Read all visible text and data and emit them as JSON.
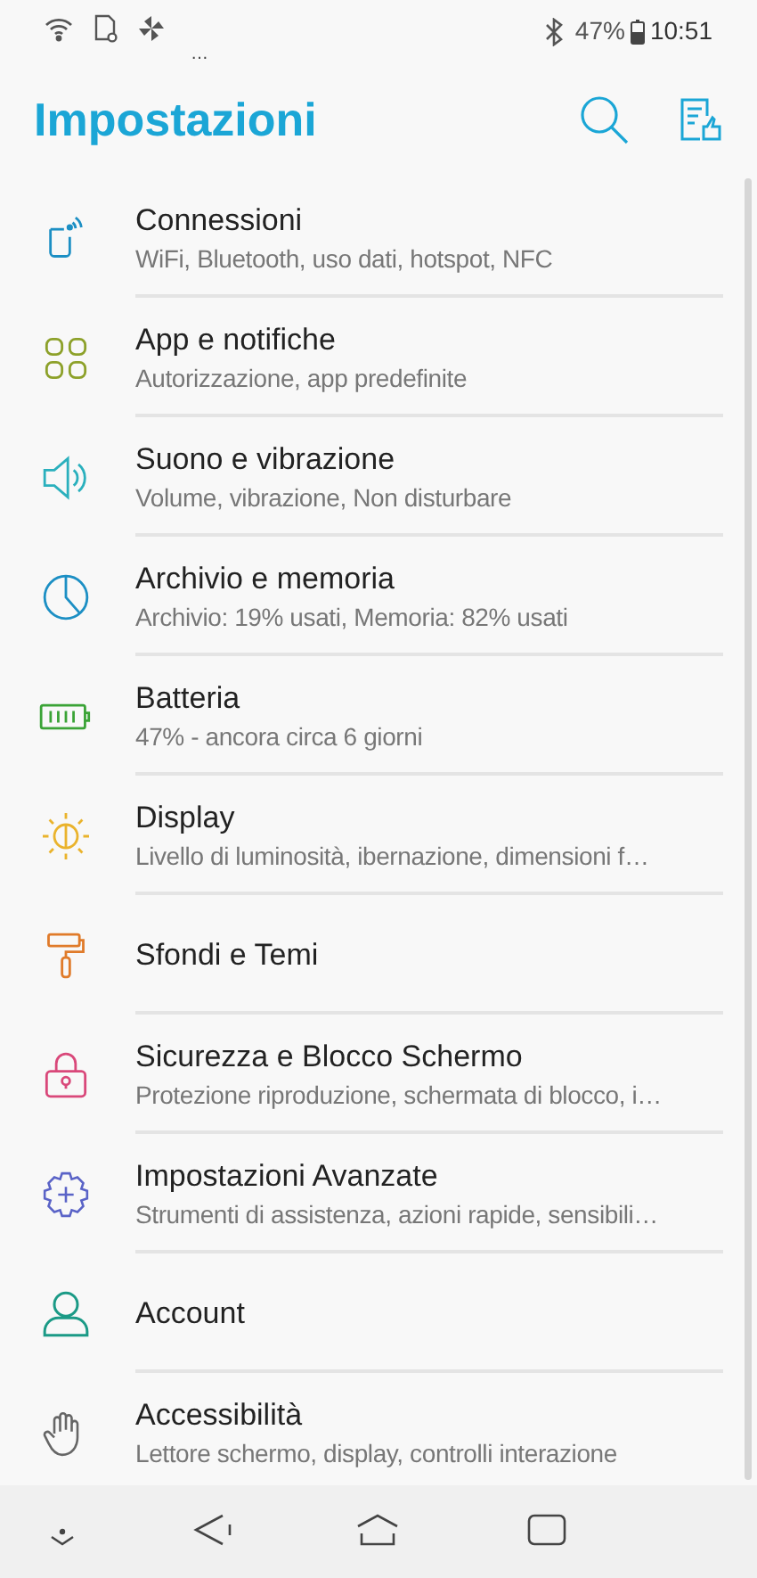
{
  "status_bar": {
    "more": "…",
    "battery": "47%",
    "time": "10:51"
  },
  "header": {
    "title": "Impostazioni"
  },
  "items": [
    {
      "title": "Connessioni",
      "subtitle": "WiFi, Bluetooth, uso dati, hotspot, NFC"
    },
    {
      "title": "App e notifiche",
      "subtitle": "Autorizzazione, app predefinite"
    },
    {
      "title": "Suono e vibrazione",
      "subtitle": "Volume, vibrazione, Non disturbare"
    },
    {
      "title": "Archivio e memoria",
      "subtitle": "Archivio: 19% usati, Memoria: 82% usati"
    },
    {
      "title": "Batteria",
      "subtitle": "47% - ancora circa 6 giorni"
    },
    {
      "title": "Display",
      "subtitle": "Livello di luminosità, ibernazione, dimensioni f…"
    },
    {
      "title": "Sfondi e Temi"
    },
    {
      "title": "Sicurezza e Blocco Schermo",
      "subtitle": "Protezione riproduzione, schermata di blocco, i…"
    },
    {
      "title": "Impostazioni Avanzate",
      "subtitle": "Strumenti di assistenza, azioni rapide, sensibili…"
    },
    {
      "title": "Account"
    },
    {
      "title": "Accessibilità",
      "subtitle": "Lettore schermo, display, controlli interazione"
    }
  ]
}
